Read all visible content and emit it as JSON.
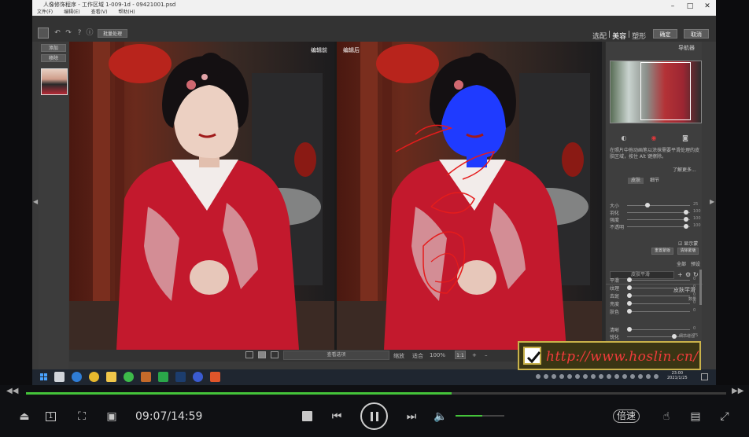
{
  "app": {
    "title": "人像修饰程序 - 工作区域 1-009-1d - 09421001.psd",
    "menu": [
      "文件(F)",
      "编辑(E)",
      "查看(V)",
      "帮助(H)"
    ],
    "window_controls": [
      "–",
      "□",
      "✕"
    ]
  },
  "toolbar": {
    "batch_label": "批量处理",
    "breadcrumb": [
      "选配",
      "美容",
      "塑形"
    ],
    "breadcrumb_active": 1,
    "ok_label": "确定",
    "cancel_label": "取消"
  },
  "left_panel": {
    "buttons": [
      "添加",
      "移除"
    ]
  },
  "photos": {
    "before_tag": "编辑前",
    "after_tag": "编辑后"
  },
  "bottom_bar": {
    "view_select": "查看选项",
    "labels": [
      "缩放",
      "适合",
      "100%"
    ],
    "zoom_value": "1:1",
    "plus": "+",
    "minus": "–"
  },
  "right_panel": {
    "nav_header": "导航器",
    "help_text": "在照片中拖动画笔以涂抹需要平滑处理的皮肤区域，按住 Alt 键擦除。",
    "more_link": "了解更多...",
    "mini_tabs": [
      "皮肤",
      "细节"
    ],
    "sliders": [
      {
        "name": "大小",
        "value": "25",
        "level": 0.3
      },
      {
        "name": "羽化",
        "value": "100",
        "level": 0.95
      },
      {
        "name": "强度",
        "value": "100",
        "level": 0.95
      },
      {
        "name": "不透明",
        "value": "100",
        "level": 0.95
      }
    ],
    "checkbox_label": "显示蒙版",
    "btn_reset": "重置蒙版",
    "btn_clear": "清除蒙版",
    "row_labels": [
      "全部",
      "预设"
    ],
    "dropdown": "皮肤平滑",
    "section2_header": "皮肤平滑",
    "section2_sub": "数量",
    "section2_sliders": [
      {
        "name": "平滑",
        "value": "0",
        "level": 0.0
      },
      {
        "name": "纹理",
        "value": "0",
        "level": 0.0
      },
      {
        "name": "去斑",
        "value": "0",
        "level": 0.0
      },
      {
        "name": "亮度",
        "value": "0",
        "level": 0.0
      },
      {
        "name": "肤色",
        "value": "0",
        "level": 0.0
      }
    ],
    "section3_sub": "细节增强",
    "section3_sliders": [
      {
        "name": "清晰",
        "value": "0",
        "level": 0.0
      },
      {
        "name": "锐化",
        "value": "75",
        "level": 0.75
      }
    ]
  },
  "taskbar": {
    "clock_time": "23:00",
    "clock_date": "2021/1/25"
  },
  "watermark": {
    "url": "http://www.hoslin.cn/"
  },
  "player": {
    "time": "09:07/14:59",
    "progress": 0.608,
    "volume": 0.55,
    "speed_label": "倍速"
  },
  "colors": {
    "progress": "#44c33a",
    "watermark_url": "#f13b3b",
    "mask_blue": "#1f3bff",
    "dress_red": "#c3192d"
  }
}
